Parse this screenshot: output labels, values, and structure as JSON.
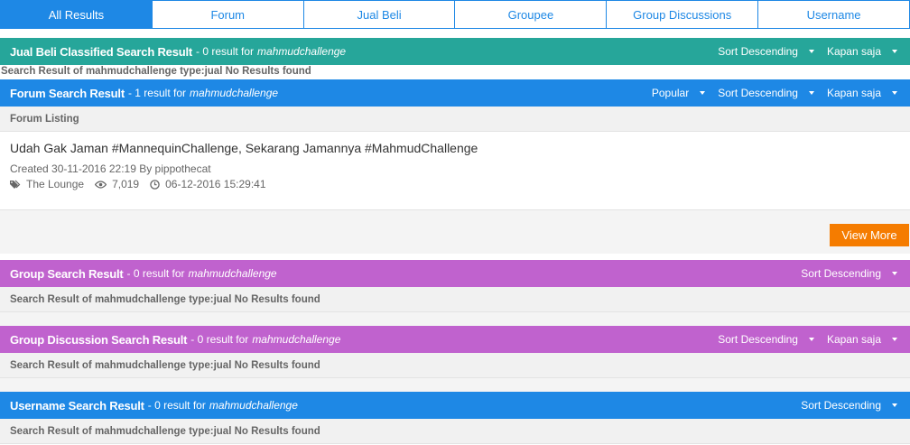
{
  "tabs": [
    {
      "label": "All Results"
    },
    {
      "label": "Forum"
    },
    {
      "label": "Jual Beli"
    },
    {
      "label": "Groupee"
    },
    {
      "label": "Group Discussions"
    },
    {
      "label": "Username"
    }
  ],
  "keyword": "mahmudchallenge",
  "jual_beli": {
    "title": "Jual Beli Classified Search Result",
    "count": "- 0 result for",
    "sort": "Sort Descending",
    "time": "Kapan saja",
    "empty_text": "Search Result of mahmudchallenge type:jual No Results found"
  },
  "forum": {
    "title": "Forum Search Result",
    "count": "- 1 result for",
    "popular": "Popular",
    "sort": "Sort Descending",
    "time": "Kapan saja",
    "listing_label": "Forum Listing",
    "thread": {
      "title": "Udah Gak Jaman #MannequinChallenge, Sekarang Jamannya #MahmudChallenge",
      "created": "Created 30-11-2016 22:19 By pippothecat",
      "category": "The Lounge",
      "views": "7,019",
      "last_post": "06-12-2016 15:29:41"
    },
    "view_more": "View More"
  },
  "group": {
    "title": "Group Search Result",
    "count": "- 0 result for",
    "sort": "Sort Descending",
    "empty_text": "Search Result of mahmudchallenge type:jual No Results found"
  },
  "group_discussion": {
    "title": "Group Discussion Search Result",
    "count": "- 0 result for",
    "sort": "Sort Descending",
    "time": "Kapan saja",
    "empty_text": "Search Result of mahmudchallenge type:jual No Results found"
  },
  "username": {
    "title": "Username Search Result",
    "count": "- 0 result for",
    "sort": "Sort Descending",
    "empty_text": "Search Result of mahmudchallenge type:jual No Results found"
  },
  "colors": {
    "tab_blue": "#1e88e5",
    "jual_beli_teal": "#26a69a",
    "forum_blue": "#1e88e5",
    "group_purple": "#c062ce",
    "view_more_orange": "#f57c00"
  }
}
